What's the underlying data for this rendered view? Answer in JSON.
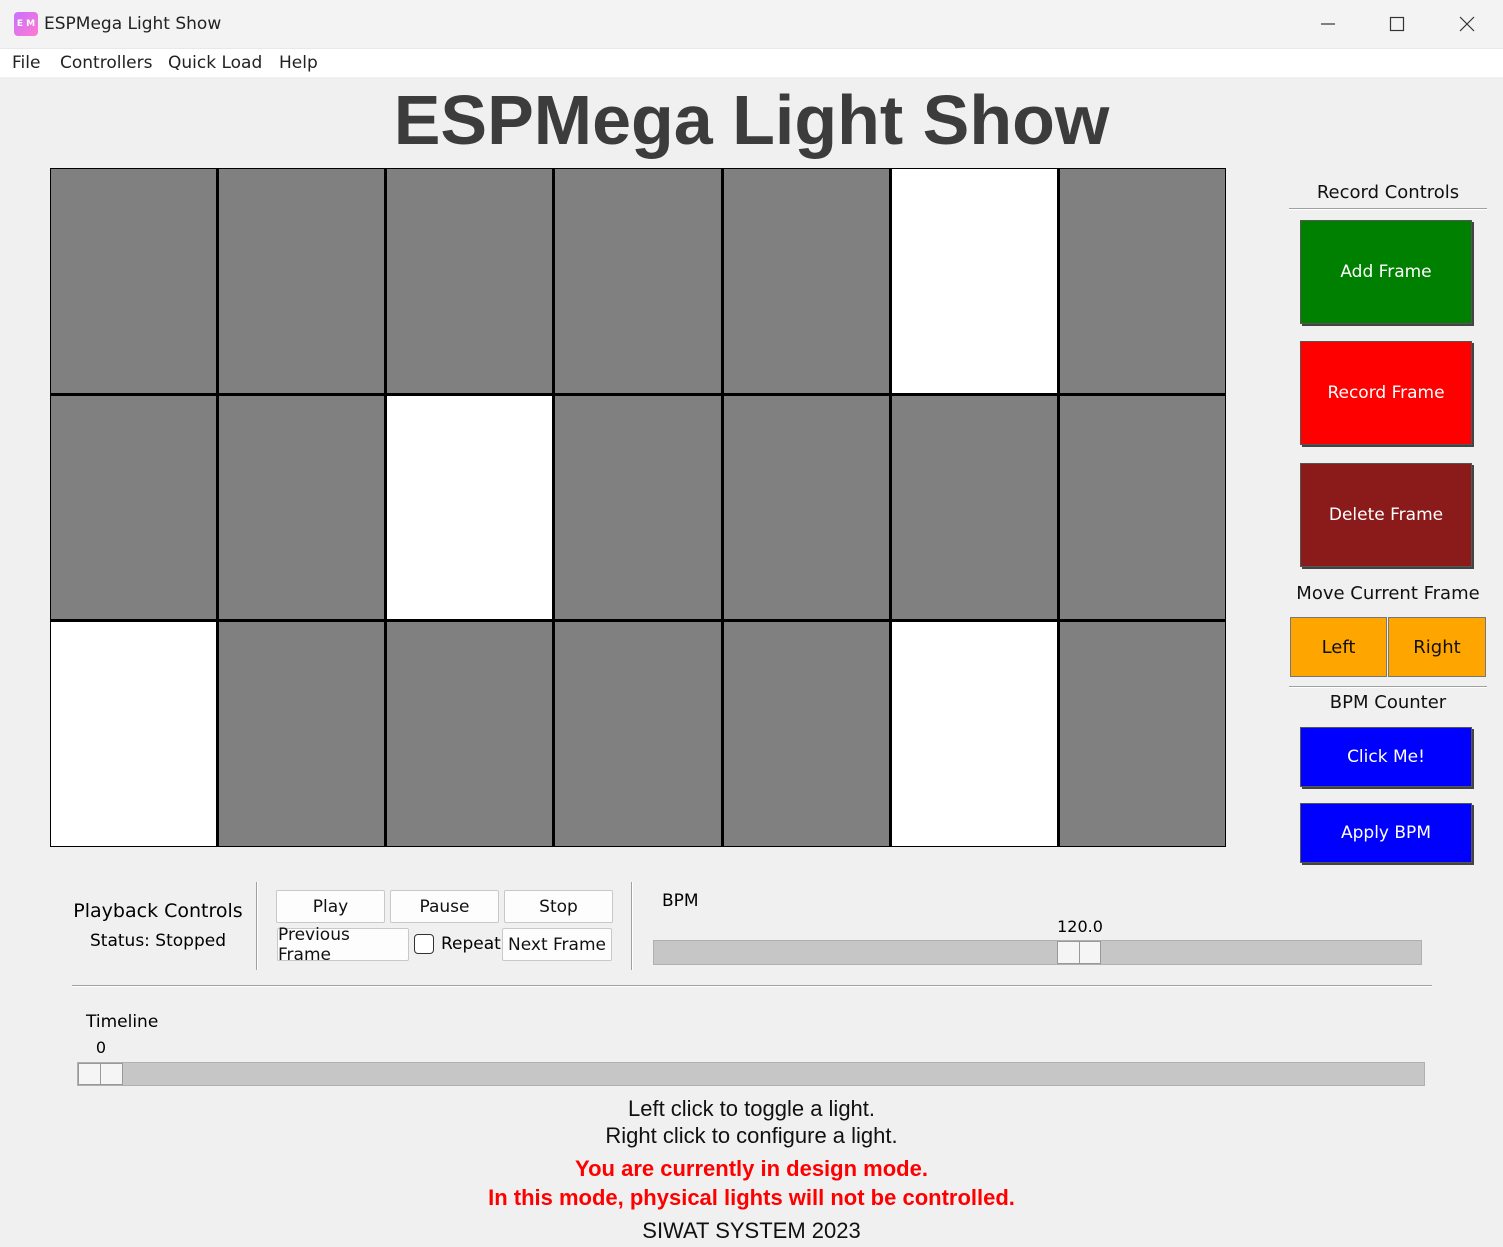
{
  "window": {
    "title": "ESPMega Light Show",
    "icon": "app-logo-icon",
    "icon_text": "E M"
  },
  "menu": [
    "File",
    "Controllers",
    "Quick Load",
    "Help"
  ],
  "heading": "ESPMega Light Show",
  "grid": {
    "rows": 3,
    "cols": 7,
    "states": [
      [
        false,
        false,
        false,
        false,
        false,
        true,
        false
      ],
      [
        false,
        false,
        true,
        false,
        false,
        false,
        false
      ],
      [
        true,
        false,
        false,
        false,
        false,
        true,
        false
      ]
    ],
    "on_color": "#ffffff",
    "off_color": "#808080"
  },
  "record_controls": {
    "title": "Record Controls",
    "add_frame": "Add Frame",
    "record_frame": "Record Frame",
    "delete_frame": "Delete Frame",
    "colors": {
      "add": "#008000",
      "record": "#ff0000",
      "delete": "#8b1a1a"
    }
  },
  "move_frame": {
    "title": "Move Current Frame",
    "left": "Left",
    "right": "Right",
    "color": "#ffa500"
  },
  "bpm_counter": {
    "title": "BPM Counter",
    "click_me": "Click Me!",
    "apply_bpm": "Apply BPM",
    "color": "#0000ff"
  },
  "playback": {
    "title": "Playback Controls",
    "status": "Status: Stopped",
    "play": "Play",
    "pause": "Pause",
    "stop": "Stop",
    "previous": "Previous Frame",
    "repeat": "Repeat",
    "next": "Next Frame",
    "repeat_checked": false
  },
  "bpm_slider": {
    "label": "BPM",
    "value": "120.0"
  },
  "timeline": {
    "label": "Timeline",
    "value": "0"
  },
  "instructions": {
    "line1": "Left click to toggle a light.",
    "line2": "Right click to configure a light.",
    "warn1": "You are currently in design mode.",
    "warn2": "In this mode, physical lights will not be controlled.",
    "footer": "SIWAT SYSTEM 2023"
  }
}
